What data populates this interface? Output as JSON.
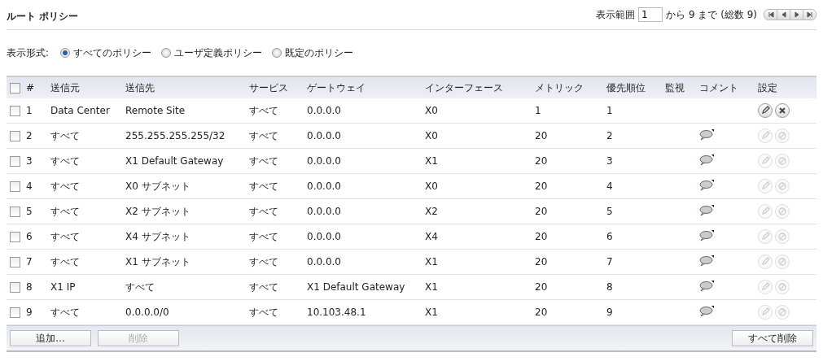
{
  "title": "ルート ポリシー",
  "pager": {
    "label": "表示範囲",
    "value": "1",
    "range": "から 9 まで (総数 9)"
  },
  "view": {
    "label": "表示形式:",
    "options": [
      {
        "label": "すべてのポリシー",
        "selected": true
      },
      {
        "label": "ユーザ定義ポリシー",
        "selected": false
      },
      {
        "label": "既定のポリシー",
        "selected": false
      }
    ]
  },
  "table": {
    "select_all": {
      "checked": false
    },
    "columns": [
      "#",
      "送信元",
      "送信先",
      "サービス",
      "ゲートウェイ",
      "インターフェース",
      "メトリック",
      "優先順位",
      "監視",
      "コメント",
      "設定"
    ],
    "rows": [
      {
        "checked": false,
        "cells": [
          "1",
          "Data Center",
          "Remote Site",
          "すべて",
          "0.0.0.0",
          "X0",
          "1",
          "1"
        ],
        "comment": false,
        "disabled": false
      },
      {
        "checked": false,
        "cells": [
          "2",
          "すべて",
          "255.255.255.255/32",
          "すべて",
          "0.0.0.0",
          "X0",
          "20",
          "2"
        ],
        "comment": true,
        "disabled": true
      },
      {
        "checked": false,
        "cells": [
          "3",
          "すべて",
          "X1 Default Gateway",
          "すべて",
          "0.0.0.0",
          "X1",
          "20",
          "3"
        ],
        "comment": true,
        "disabled": true
      },
      {
        "checked": false,
        "cells": [
          "4",
          "すべて",
          "X0 サブネット",
          "すべて",
          "0.0.0.0",
          "X0",
          "20",
          "4"
        ],
        "comment": true,
        "disabled": true
      },
      {
        "checked": false,
        "cells": [
          "5",
          "すべて",
          "X2 サブネット",
          "すべて",
          "0.0.0.0",
          "X2",
          "20",
          "5"
        ],
        "comment": true,
        "disabled": true
      },
      {
        "checked": false,
        "cells": [
          "6",
          "すべて",
          "X4 サブネット",
          "すべて",
          "0.0.0.0",
          "X4",
          "20",
          "6"
        ],
        "comment": true,
        "disabled": true
      },
      {
        "checked": false,
        "cells": [
          "7",
          "すべて",
          "X1 サブネット",
          "すべて",
          "0.0.0.0",
          "X1",
          "20",
          "7"
        ],
        "comment": true,
        "disabled": true
      },
      {
        "checked": false,
        "cells": [
          "8",
          "X1 IP",
          "すべて",
          "すべて",
          "X1 Default Gateway",
          "X1",
          "20",
          "8"
        ],
        "comment": true,
        "disabled": true
      },
      {
        "checked": false,
        "cells": [
          "9",
          "すべて",
          "0.0.0.0/0",
          "すべて",
          "10.103.48.1",
          "X1",
          "20",
          "9"
        ],
        "comment": true,
        "disabled": true
      }
    ]
  },
  "footer": {
    "left_buttons": [
      {
        "label": "追加...",
        "disabled": false
      },
      {
        "label": "削除",
        "disabled": true
      }
    ],
    "right_buttons": [
      {
        "label": "すべて削除",
        "disabled": false
      }
    ]
  }
}
